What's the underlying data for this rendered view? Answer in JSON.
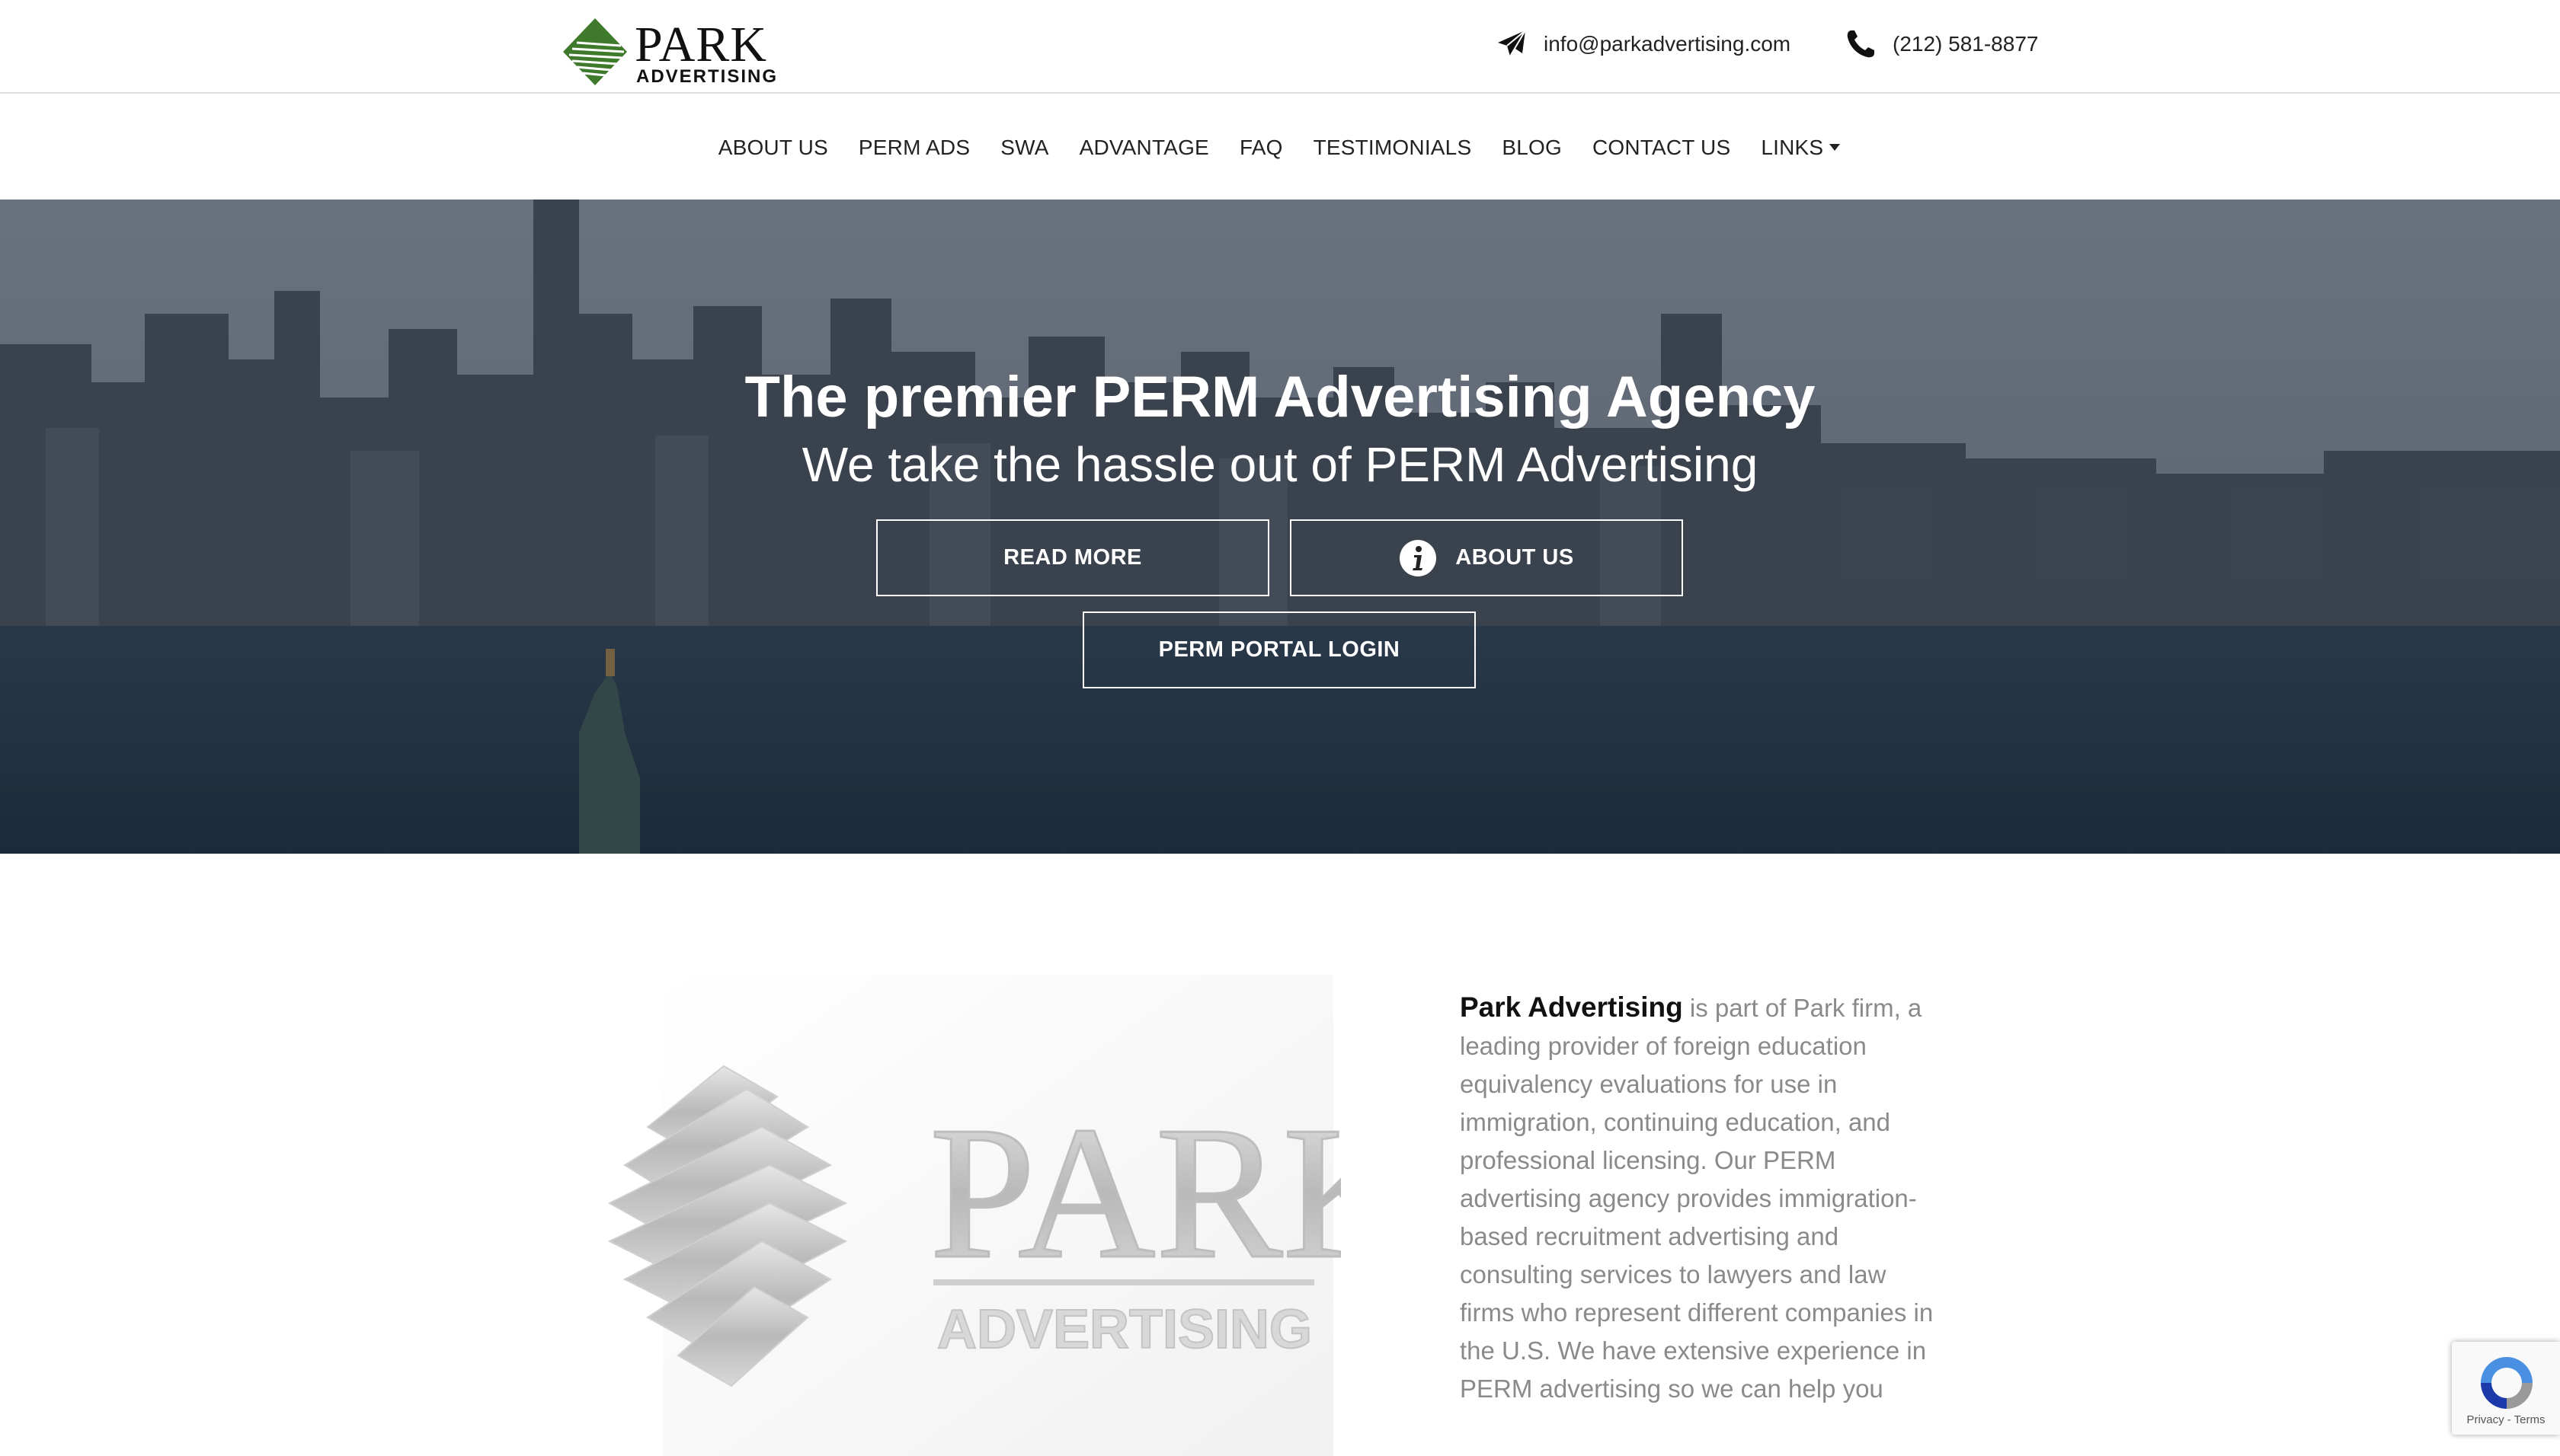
{
  "header": {
    "logo_word": "PARK",
    "logo_sub": "ADVERTISING",
    "email": "info@parkadvertising.com",
    "phone": "(212) 581-8877"
  },
  "nav": {
    "items": [
      {
        "label": "ABOUT US"
      },
      {
        "label": "PERM ADS"
      },
      {
        "label": "SWA"
      },
      {
        "label": "ADVANTAGE"
      },
      {
        "label": "FAQ"
      },
      {
        "label": "TESTIMONIALS"
      },
      {
        "label": "BLOG"
      },
      {
        "label": "CONTACT US"
      },
      {
        "label": "LINKS"
      }
    ]
  },
  "hero": {
    "title": "The premier PERM Advertising Agency",
    "subtitle": "We take the hassle out of PERM Advertising",
    "read_more_label": "READ MORE",
    "about_label": "ABOUT US",
    "portal_label": "PERM PORTAL LOGIN"
  },
  "about": {
    "lead": "Park Advertising",
    "body": " is part of Park firm, a leading provider of foreign education equivalency evaluations for use in immigration, continuing education, and professional licensing. Our PERM advertising agency provides immigration-based recruitment advertising and consulting services to lawyers and law firms who represent different companies in the U.S. We have extensive experience in PERM advertising so we can help you",
    "image_word": "PARK",
    "image_sub": "ADVERTISING"
  },
  "recaptcha": {
    "links": "Privacy - Terms"
  },
  "colors": {
    "logo_green": "#3f7a2c",
    "hero_overlay": "#1c2838",
    "body_text": "#8a8a8a"
  },
  "icons": {
    "email": "paper-plane-icon",
    "phone": "phone-icon",
    "about_button": "info-icon",
    "links_dropdown": "caret-down-icon"
  }
}
